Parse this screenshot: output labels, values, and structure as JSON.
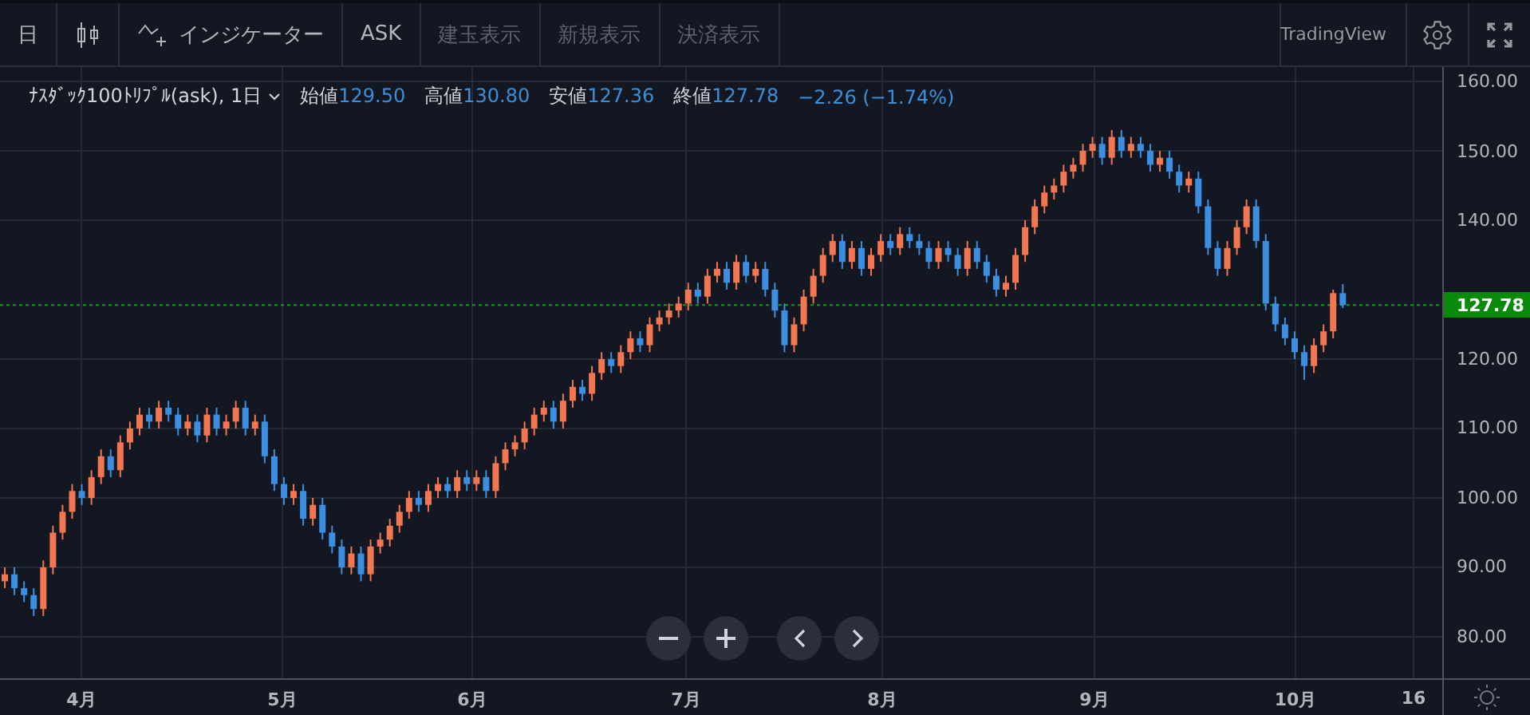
{
  "toolbar": {
    "interval": "日",
    "indicators_label": "インジケーター",
    "buttons": [
      {
        "label": "ASK",
        "disabled": false
      },
      {
        "label": "建玉表示",
        "disabled": true
      },
      {
        "label": "新規表示",
        "disabled": true
      },
      {
        "label": "決済表示",
        "disabled": true
      }
    ],
    "brand": "TradingView"
  },
  "legend": {
    "symbol": "ﾅｽﾀﾞｯｸ100ﾄﾘﾌﾟﾙ(ask), 1日",
    "fields": [
      {
        "label": "始値",
        "value": "129.50"
      },
      {
        "label": "高値",
        "value": "130.80"
      },
      {
        "label": "安値",
        "value": "127.36"
      },
      {
        "label": "終値",
        "value": "127.78"
      }
    ],
    "change": "−2.26 (−1.74%)"
  },
  "chart_data": {
    "type": "candlestick",
    "categories": [
      null,
      null,
      null,
      null,
      null,
      null,
      null,
      null,
      null,
      null,
      null,
      null,
      null,
      null,
      null,
      null,
      null,
      null,
      null,
      null,
      null,
      null,
      null,
      null,
      null,
      null,
      null,
      null,
      null,
      null,
      null,
      null,
      null,
      null,
      null,
      null,
      null,
      null,
      null,
      null,
      null,
      null,
      null,
      null,
      null,
      null,
      null,
      null,
      null,
      null,
      null,
      null,
      null,
      null,
      null,
      null,
      null,
      null,
      null,
      null,
      null,
      null,
      null,
      null,
      null,
      null,
      null,
      null,
      null,
      null,
      null,
      null,
      null,
      null,
      null,
      null,
      null,
      null,
      null,
      null,
      null,
      null,
      null,
      null,
      null,
      null,
      null,
      null,
      null,
      null,
      null,
      null,
      null,
      null,
      null,
      null,
      null,
      null,
      null,
      null,
      null,
      null,
      null,
      null,
      null,
      null,
      null,
      null,
      null,
      null,
      null,
      null,
      null,
      null,
      null,
      null,
      null,
      null,
      null,
      null,
      null,
      null,
      null,
      null,
      null,
      null,
      null,
      null,
      null,
      null,
      null,
      null,
      null,
      null,
      null,
      null,
      null,
      null,
      null,
      null,
      null,
      null,
      null,
      null,
      null,
      null,
      null,
      null,
      null,
      null
    ],
    "ohlc": [
      [
        88,
        90,
        87,
        89
      ],
      [
        89,
        90,
        86,
        87
      ],
      [
        87,
        88,
        85,
        86
      ],
      [
        86,
        87,
        83,
        84
      ],
      [
        84,
        91,
        83,
        90
      ],
      [
        90,
        96,
        89,
        95
      ],
      [
        95,
        99,
        94,
        98
      ],
      [
        98,
        102,
        97,
        101
      ],
      [
        101,
        102,
        99,
        100
      ],
      [
        100,
        104,
        99,
        103
      ],
      [
        103,
        107,
        102,
        106
      ],
      [
        106,
        107,
        103,
        104
      ],
      [
        104,
        109,
        103,
        108
      ],
      [
        108,
        111,
        107,
        110
      ],
      [
        110,
        113,
        109,
        112
      ],
      [
        112,
        113,
        110,
        111
      ],
      [
        111,
        114,
        110,
        113
      ],
      [
        113,
        114,
        111,
        112
      ],
      [
        112,
        113,
        109,
        110
      ],
      [
        110,
        112,
        109,
        111
      ],
      [
        111,
        112,
        108,
        109
      ],
      [
        109,
        113,
        108,
        112
      ],
      [
        112,
        113,
        109,
        110
      ],
      [
        110,
        112,
        109,
        111
      ],
      [
        111,
        114,
        110,
        113
      ],
      [
        113,
        114,
        109,
        110
      ],
      [
        110,
        112,
        109,
        111
      ],
      [
        111,
        112,
        105,
        106
      ],
      [
        106,
        107,
        101,
        102
      ],
      [
        102,
        103,
        99,
        100
      ],
      [
        100,
        102,
        99,
        101
      ],
      [
        101,
        102,
        96,
        97
      ],
      [
        97,
        100,
        96,
        99
      ],
      [
        99,
        100,
        94,
        95
      ],
      [
        95,
        96,
        92,
        93
      ],
      [
        93,
        94,
        89,
        90
      ],
      [
        90,
        93,
        89,
        92
      ],
      [
        92,
        93,
        88,
        89
      ],
      [
        89,
        94,
        88,
        93
      ],
      [
        93,
        95,
        92,
        94
      ],
      [
        94,
        97,
        93,
        96
      ],
      [
        96,
        99,
        95,
        98
      ],
      [
        98,
        101,
        97,
        100
      ],
      [
        100,
        101,
        98,
        99
      ],
      [
        99,
        102,
        98,
        101
      ],
      [
        101,
        103,
        100,
        102
      ],
      [
        102,
        103,
        100,
        101
      ],
      [
        101,
        104,
        100,
        103
      ],
      [
        103,
        104,
        101,
        102
      ],
      [
        102,
        104,
        101,
        103
      ],
      [
        103,
        104,
        100,
        101
      ],
      [
        101,
        106,
        100,
        105
      ],
      [
        105,
        108,
        104,
        107
      ],
      [
        107,
        109,
        106,
        108
      ],
      [
        108,
        111,
        107,
        110
      ],
      [
        110,
        113,
        109,
        112
      ],
      [
        112,
        114,
        111,
        113
      ],
      [
        113,
        114,
        110,
        111
      ],
      [
        111,
        115,
        110,
        114
      ],
      [
        114,
        117,
        113,
        116
      ],
      [
        116,
        117,
        114,
        115
      ],
      [
        115,
        119,
        114,
        118
      ],
      [
        118,
        121,
        117,
        120
      ],
      [
        120,
        121,
        118,
        119
      ],
      [
        119,
        122,
        118,
        121
      ],
      [
        121,
        124,
        120,
        123
      ],
      [
        123,
        124,
        121,
        122
      ],
      [
        122,
        126,
        121,
        125
      ],
      [
        125,
        127,
        124,
        126
      ],
      [
        126,
        128,
        125,
        127
      ],
      [
        127,
        129,
        126,
        128
      ],
      [
        128,
        131,
        127,
        130
      ],
      [
        130,
        131,
        128,
        129
      ],
      [
        129,
        133,
        128,
        132
      ],
      [
        132,
        134,
        131,
        133
      ],
      [
        133,
        134,
        130,
        131
      ],
      [
        131,
        135,
        130,
        134
      ],
      [
        134,
        135,
        131,
        132
      ],
      [
        132,
        134,
        131,
        133
      ],
      [
        133,
        134,
        129,
        130
      ],
      [
        130,
        131,
        126,
        127
      ],
      [
        127,
        128,
        121,
        122
      ],
      [
        122,
        126,
        121,
        125
      ],
      [
        125,
        130,
        124,
        129
      ],
      [
        129,
        133,
        128,
        132
      ],
      [
        132,
        136,
        131,
        135
      ],
      [
        135,
        138,
        134,
        137
      ],
      [
        137,
        138,
        133,
        134
      ],
      [
        134,
        137,
        133,
        136
      ],
      [
        136,
        137,
        132,
        133
      ],
      [
        133,
        136,
        132,
        135
      ],
      [
        135,
        138,
        134,
        137
      ],
      [
        137,
        138,
        135,
        136
      ],
      [
        136,
        139,
        135,
        138
      ],
      [
        138,
        139,
        136,
        137
      ],
      [
        137,
        138,
        135,
        136
      ],
      [
        136,
        137,
        133,
        134
      ],
      [
        134,
        137,
        133,
        136
      ],
      [
        136,
        137,
        134,
        135
      ],
      [
        135,
        136,
        132,
        133
      ],
      [
        133,
        137,
        132,
        136
      ],
      [
        136,
        137,
        133,
        134
      ],
      [
        134,
        135,
        131,
        132
      ],
      [
        132,
        133,
        129,
        130
      ],
      [
        130,
        132,
        129,
        131
      ],
      [
        131,
        136,
        130,
        135
      ],
      [
        135,
        140,
        134,
        139
      ],
      [
        139,
        143,
        138,
        142
      ],
      [
        142,
        145,
        141,
        144
      ],
      [
        144,
        146,
        143,
        145
      ],
      [
        145,
        148,
        144,
        147
      ],
      [
        147,
        149,
        146,
        148
      ],
      [
        148,
        151,
        147,
        150
      ],
      [
        150,
        152,
        149,
        151
      ],
      [
        151,
        152,
        148,
        149
      ],
      [
        149,
        153,
        148,
        152
      ],
      [
        152,
        153,
        149,
        150
      ],
      [
        150,
        152,
        149,
        151
      ],
      [
        151,
        152,
        149,
        150
      ],
      [
        150,
        151,
        147,
        148
      ],
      [
        148,
        150,
        147,
        149
      ],
      [
        149,
        150,
        146,
        147
      ],
      [
        147,
        148,
        144,
        145
      ],
      [
        145,
        147,
        144,
        146
      ],
      [
        146,
        147,
        141,
        142
      ],
      [
        142,
        143,
        135,
        136
      ],
      [
        136,
        137,
        132,
        133
      ],
      [
        133,
        137,
        132,
        136
      ],
      [
        136,
        140,
        135,
        139
      ],
      [
        139,
        143,
        138,
        142
      ],
      [
        142,
        143,
        136,
        137
      ],
      [
        137,
        138,
        127,
        128
      ],
      [
        128,
        129,
        124,
        125
      ],
      [
        125,
        126,
        122,
        123
      ],
      [
        123,
        124,
        120,
        121
      ],
      [
        121,
        122,
        117,
        119
      ],
      [
        119,
        123,
        118,
        122
      ],
      [
        122,
        125,
        121,
        124
      ],
      [
        124,
        130,
        123,
        129.5
      ],
      [
        129.5,
        130.8,
        127.36,
        127.78
      ],
      null,
      null,
      null,
      null,
      null,
      null,
      null,
      null,
      null,
      null
    ],
    "ylim": [
      74.02,
      162.07
    ],
    "grid": true,
    "ref_lines": [
      {
        "axis": "y",
        "value": 127.78,
        "label": "127.78"
      }
    ],
    "yticks": [
      {
        "value": 160,
        "label": "160.00"
      },
      {
        "value": 150,
        "label": "150.00"
      },
      {
        "value": 140,
        "label": "140.00"
      },
      {
        "value": 120,
        "label": "120.00"
      },
      {
        "value": 110,
        "label": "110.00"
      },
      {
        "value": 100,
        "label": "100.00"
      },
      {
        "value": 90,
        "label": "90.00"
      },
      {
        "value": 80,
        "label": "80.00"
      }
    ]
  },
  "time_axis": {
    "ticks": [
      "4月",
      "5月",
      "6月",
      "7月",
      "8月",
      "9月",
      "10月",
      "16"
    ]
  }
}
